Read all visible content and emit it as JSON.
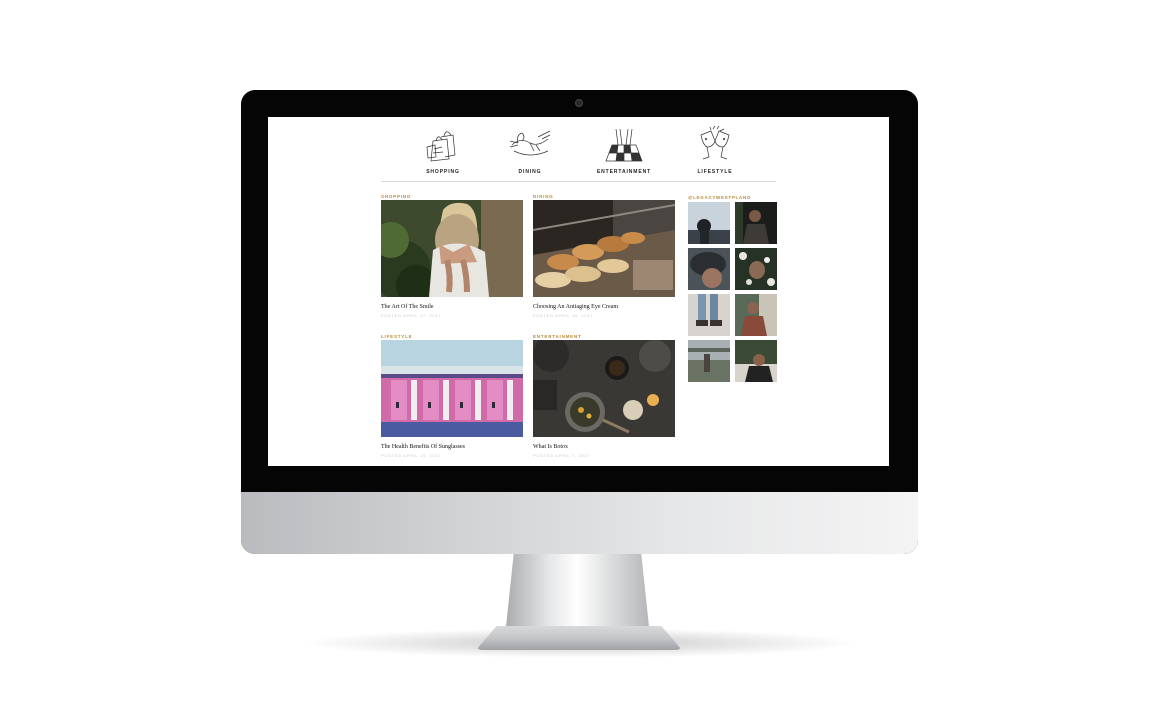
{
  "nav": {
    "items": [
      {
        "label": "SHOPPING",
        "icon": "shopping-bags-icon"
      },
      {
        "label": "DINING",
        "icon": "lobster-dish-icon"
      },
      {
        "label": "ENTERTAINMENT",
        "icon": "cinema-screen-icon"
      },
      {
        "label": "LIFESTYLE",
        "icon": "champagne-toast-icon"
      }
    ]
  },
  "posts": [
    {
      "category": "SHOPPING",
      "title": "The Art Of The Smile",
      "date": "POSTED APRIL 27, 2017"
    },
    {
      "category": "DINING",
      "title": "Choosing An Antiaging Eye Cream",
      "date": "POSTED APRIL 16, 2017"
    },
    {
      "category": "LIFESTYLE",
      "title": "The Health Benefits Of Sunglasses",
      "date": "POSTED APRIL 15, 2017"
    },
    {
      "category": "ENTERTAINMENT",
      "title": "What Is Botox",
      "date": "POSTED APRIL 7, 2017"
    }
  ],
  "instagram": {
    "handle": "@LEGACYWESTPLANO",
    "tile_count": 8
  },
  "colors": {
    "accent": "#b88a33",
    "date_text": "#c8c8c8",
    "title_text": "#111111",
    "bezel": "#050505"
  }
}
